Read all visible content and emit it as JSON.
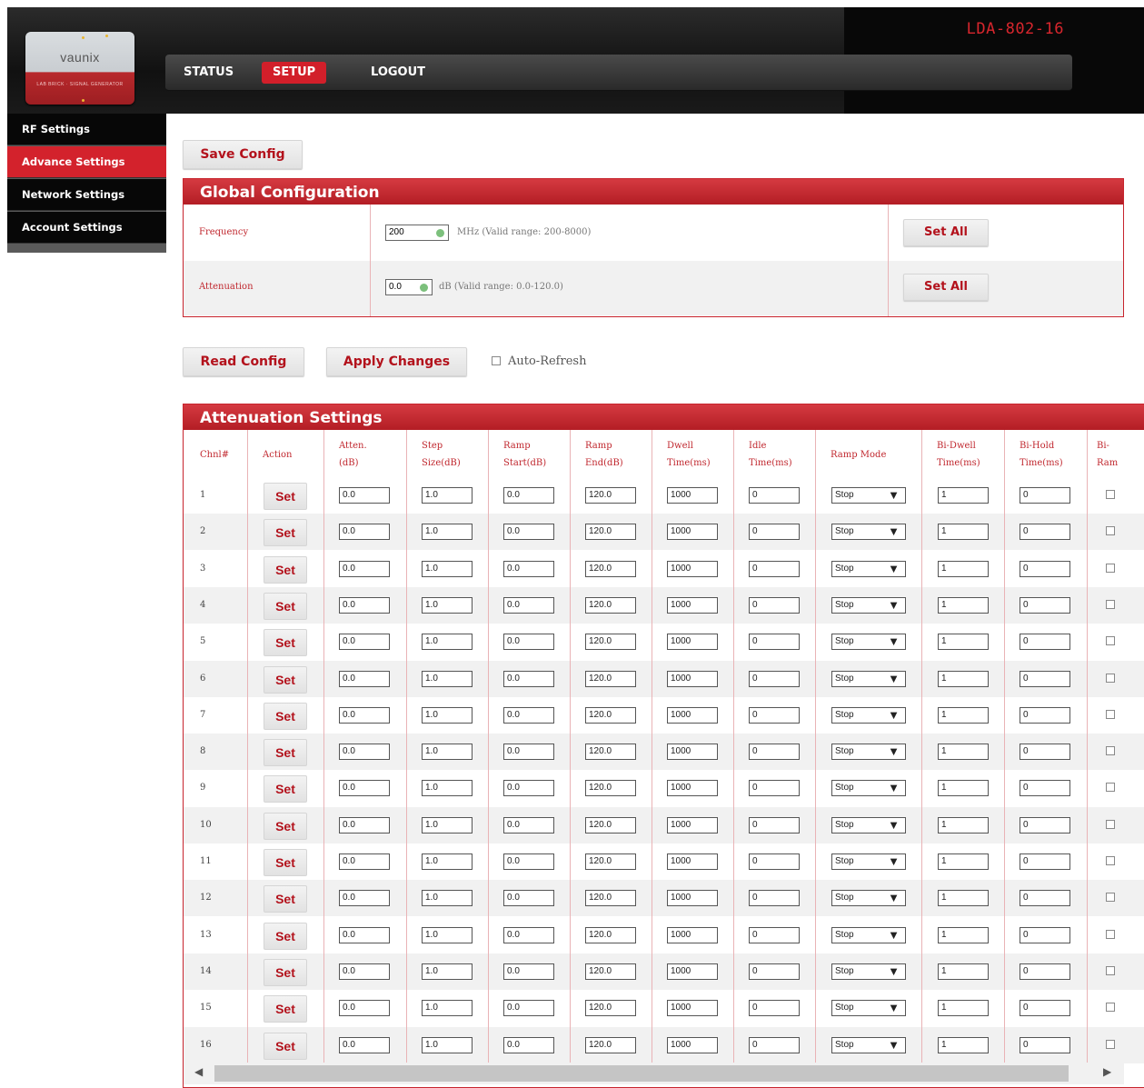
{
  "header": {
    "logo_text": "vaunix",
    "logo_sub": "LAB BRICK · SIGNAL GENERATOR",
    "model": "LDA-802-16",
    "nav": [
      {
        "label": "STATUS",
        "active": false
      },
      {
        "label": "SETUP",
        "active": true
      },
      {
        "label": "LOGOUT",
        "active": false
      }
    ]
  },
  "sidebar": {
    "items": [
      {
        "label": "RF Settings",
        "active": false
      },
      {
        "label": "Advance Settings",
        "active": true
      },
      {
        "label": "Network Settings",
        "active": false
      },
      {
        "label": "Account Settings",
        "active": false
      }
    ]
  },
  "buttons": {
    "save_config": "Save Config",
    "read_config": "Read Config",
    "apply_changes": "Apply Changes",
    "auto_refresh": "Auto-Refresh"
  },
  "global": {
    "title": "Global Configuration",
    "rows": [
      {
        "label": "Frequency",
        "value": "200",
        "hint": "MHz (Valid range: 200-8000)",
        "button": "Set All"
      },
      {
        "label": "Attenuation",
        "value": "0.0",
        "hint": "dB (Valid range: 0.0-120.0)",
        "button": "Set All"
      }
    ]
  },
  "attenuation": {
    "title": "Attenuation Settings",
    "headers": [
      [
        "Chnl#"
      ],
      [
        "Action"
      ],
      [
        "Atten.",
        "(dB)"
      ],
      [
        "Step",
        "Size(dB)"
      ],
      [
        "Ramp",
        "Start(dB)"
      ],
      [
        "Ramp",
        "End(dB)"
      ],
      [
        "Dwell",
        "Time(ms)"
      ],
      [
        "Idle",
        "Time(ms)"
      ],
      [
        "Ramp Mode"
      ],
      [
        "Bi-Dwell",
        "Time(ms)"
      ],
      [
        "Bi-Hold",
        "Time(ms)"
      ],
      [
        "Bi-",
        "Ram"
      ]
    ],
    "set_label": "Set",
    "rows": [
      {
        "ch": "1",
        "atten": "0.0",
        "step": "1.0",
        "start": "0.0",
        "end": "120.0",
        "dwell": "1000",
        "idle": "0",
        "mode": "Stop",
        "bidwell": "1",
        "bihold": "0"
      },
      {
        "ch": "2",
        "atten": "0.0",
        "step": "1.0",
        "start": "0.0",
        "end": "120.0",
        "dwell": "1000",
        "idle": "0",
        "mode": "Stop",
        "bidwell": "1",
        "bihold": "0"
      },
      {
        "ch": "3",
        "atten": "0.0",
        "step": "1.0",
        "start": "0.0",
        "end": "120.0",
        "dwell": "1000",
        "idle": "0",
        "mode": "Stop",
        "bidwell": "1",
        "bihold": "0"
      },
      {
        "ch": "4",
        "atten": "0.0",
        "step": "1.0",
        "start": "0.0",
        "end": "120.0",
        "dwell": "1000",
        "idle": "0",
        "mode": "Stop",
        "bidwell": "1",
        "bihold": "0"
      },
      {
        "ch": "5",
        "atten": "0.0",
        "step": "1.0",
        "start": "0.0",
        "end": "120.0",
        "dwell": "1000",
        "idle": "0",
        "mode": "Stop",
        "bidwell": "1",
        "bihold": "0"
      },
      {
        "ch": "6",
        "atten": "0.0",
        "step": "1.0",
        "start": "0.0",
        "end": "120.0",
        "dwell": "1000",
        "idle": "0",
        "mode": "Stop",
        "bidwell": "1",
        "bihold": "0"
      },
      {
        "ch": "7",
        "atten": "0.0",
        "step": "1.0",
        "start": "0.0",
        "end": "120.0",
        "dwell": "1000",
        "idle": "0",
        "mode": "Stop",
        "bidwell": "1",
        "bihold": "0"
      },
      {
        "ch": "8",
        "atten": "0.0",
        "step": "1.0",
        "start": "0.0",
        "end": "120.0",
        "dwell": "1000",
        "idle": "0",
        "mode": "Stop",
        "bidwell": "1",
        "bihold": "0"
      },
      {
        "ch": "9",
        "atten": "0.0",
        "step": "1.0",
        "start": "0.0",
        "end": "120.0",
        "dwell": "1000",
        "idle": "0",
        "mode": "Stop",
        "bidwell": "1",
        "bihold": "0"
      },
      {
        "ch": "10",
        "atten": "0.0",
        "step": "1.0",
        "start": "0.0",
        "end": "120.0",
        "dwell": "1000",
        "idle": "0",
        "mode": "Stop",
        "bidwell": "1",
        "bihold": "0"
      },
      {
        "ch": "11",
        "atten": "0.0",
        "step": "1.0",
        "start": "0.0",
        "end": "120.0",
        "dwell": "1000",
        "idle": "0",
        "mode": "Stop",
        "bidwell": "1",
        "bihold": "0"
      },
      {
        "ch": "12",
        "atten": "0.0",
        "step": "1.0",
        "start": "0.0",
        "end": "120.0",
        "dwell": "1000",
        "idle": "0",
        "mode": "Stop",
        "bidwell": "1",
        "bihold": "0"
      },
      {
        "ch": "13",
        "atten": "0.0",
        "step": "1.0",
        "start": "0.0",
        "end": "120.0",
        "dwell": "1000",
        "idle": "0",
        "mode": "Stop",
        "bidwell": "1",
        "bihold": "0"
      },
      {
        "ch": "14",
        "atten": "0.0",
        "step": "1.0",
        "start": "0.0",
        "end": "120.0",
        "dwell": "1000",
        "idle": "0",
        "mode": "Stop",
        "bidwell": "1",
        "bihold": "0"
      },
      {
        "ch": "15",
        "atten": "0.0",
        "step": "1.0",
        "start": "0.0",
        "end": "120.0",
        "dwell": "1000",
        "idle": "0",
        "mode": "Stop",
        "bidwell": "1",
        "bihold": "0"
      },
      {
        "ch": "16",
        "atten": "0.0",
        "step": "1.0",
        "start": "0.0",
        "end": "120.0",
        "dwell": "1000",
        "idle": "0",
        "mode": "Stop",
        "bidwell": "1",
        "bihold": "0"
      }
    ]
  },
  "colors": {
    "accent": "#d3222c",
    "header_bg": "#111111",
    "label_red": "#c0272e"
  }
}
